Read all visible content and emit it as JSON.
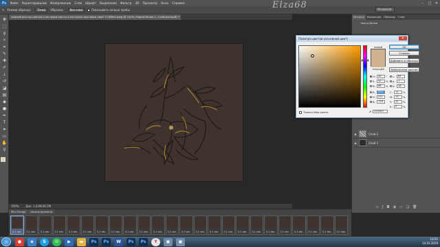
{
  "app": {
    "logo": "Ps",
    "window_controls": [
      "–",
      "□",
      "✕"
    ]
  },
  "menu": [
    "Файл",
    "Редактирование",
    "Изображение",
    "Слои",
    "Шрифт",
    "Выделение",
    "Фильтр",
    "3D",
    "Просмотр",
    "Окно",
    "Справка"
  ],
  "options_bar": {
    "sample_size_label": "Размер образца:",
    "sample_size_value": "Точка",
    "sample_label": "Образец:",
    "sample_value": "Все слои",
    "show_ring_label": "Показывать кольцо пробы"
  },
  "watermark": "Elza68",
  "workspace_select": "Основная",
  "document_tab": "черный вектор цветов и не самое место и нестрахн прстиван-свой 7138ffc0.jpeg @ 100% (Черно-белое 1, Слой-маска/8) *",
  "status": {
    "zoom": "100%",
    "doc": "Док: 1,03М/36,5М"
  },
  "timeline": {
    "tabs": [
      "Mini Bridge",
      "Шкала времени"
    ],
    "frame_count": 24,
    "frame_duration": "0,1 сек."
  },
  "panels": {
    "tabs": [
      "История",
      "Коррекция",
      "Образцы",
      "Слои"
    ],
    "history": [
      "Черно-белое"
    ],
    "layers": [
      {
        "name": "Слой 2",
        "thumb": "stripe"
      },
      {
        "name": "Слой 1",
        "thumb": "dark"
      }
    ]
  },
  "picker": {
    "title": "Палитра цветов (основной цвет)",
    "close": "✕",
    "new_label": "новый",
    "current_label": "текущий",
    "buttons": {
      "ok": "OK",
      "cancel": "Отмена",
      "add": "Добавить в образцы",
      "libraries": "Библиотеки цветов"
    },
    "fields": {
      "H": {
        "label": "H:",
        "value": "42",
        "unit": "°"
      },
      "S": {
        "label": "S:",
        "value": "32",
        "unit": "%"
      },
      "B": {
        "label": "B:",
        "value": "86",
        "unit": "%"
      },
      "R": {
        "label": "R:",
        "value": "220"
      },
      "G": {
        "label": "G:",
        "value": "211"
      },
      "Bl": {
        "label": "B:",
        "value": "179"
      },
      "L": {
        "label": "L:",
        "value": "85"
      },
      "a": {
        "label": "a:",
        "value": "1"
      },
      "b": {
        "label": "b:",
        "value": "18"
      },
      "C": {
        "label": "C:",
        "value": "11",
        "unit": "%"
      },
      "M": {
        "label": "M:",
        "value": "13",
        "unit": "%"
      },
      "Y": {
        "label": "Y:",
        "value": "31",
        "unit": "%"
      },
      "K": {
        "label": "K:",
        "value": "0",
        "unit": "%"
      }
    },
    "web_only": "Только Web-цвета",
    "hex_label": "#",
    "hex_value": "e1d3b3",
    "color_new": "#d3b38f",
    "color_current": "#d3b38f"
  },
  "taskbar": {
    "apps": [
      "chrome-icon",
      "explorer-icon",
      "skype-icon",
      "whatsapp-icon",
      "media-icon",
      "folder-icon",
      "photoshop-icon",
      "photoshop-icon",
      "word-icon",
      "photoshop-icon",
      "photoshop-icon",
      "yandex-icon",
      "image-icon",
      "image-icon"
    ],
    "time": "13:51",
    "date": "14.03.2019"
  }
}
